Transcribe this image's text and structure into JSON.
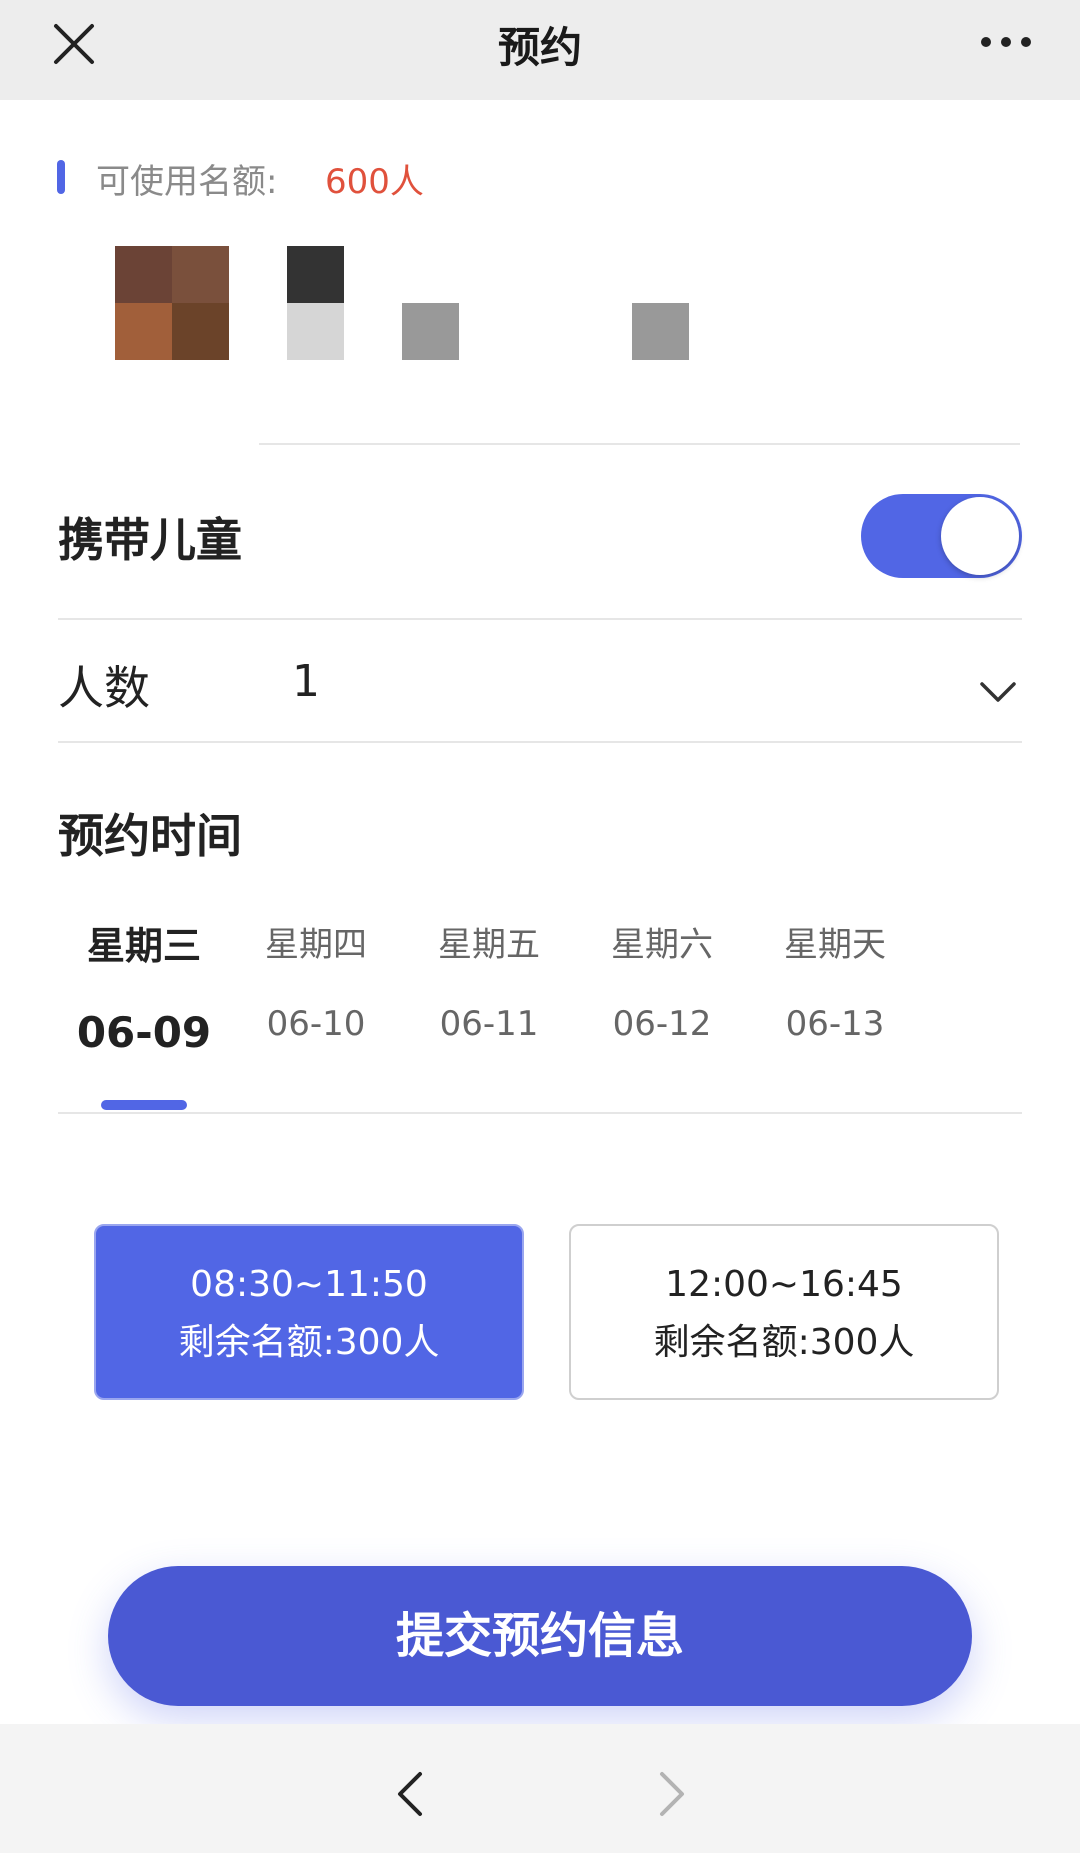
{
  "header": {
    "title": "预约",
    "close_icon": "close-icon",
    "more_icon": "more-dots-icon"
  },
  "quota": {
    "label": "可使用名额:",
    "value": "600人"
  },
  "children": {
    "label": "携带儿童",
    "enabled": true
  },
  "count": {
    "label": "人数",
    "value": "1",
    "icon": "chevron-down-icon"
  },
  "schedule": {
    "title": "预约时间",
    "days": [
      {
        "weekday": "星期三",
        "date": "06-09",
        "selected": true
      },
      {
        "weekday": "星期四",
        "date": "06-10",
        "selected": false
      },
      {
        "weekday": "星期五",
        "date": "06-11",
        "selected": false
      },
      {
        "weekday": "星期六",
        "date": "06-12",
        "selected": false
      },
      {
        "weekday": "星期天",
        "date": "06-13",
        "selected": false
      }
    ],
    "slots": [
      {
        "time": "08:30~11:50",
        "remaining": "剩余名额:300人",
        "selected": true
      },
      {
        "time": "12:00~16:45",
        "remaining": "剩余名额:300人",
        "selected": false
      }
    ]
  },
  "submit": {
    "label": "提交预约信息"
  },
  "colors": {
    "accent": "#5166e5",
    "button": "#4a59d3",
    "quota_value": "#e0513c"
  },
  "bottom_nav": {
    "back_icon": "chevron-left-icon",
    "forward_icon": "chevron-right-icon"
  }
}
